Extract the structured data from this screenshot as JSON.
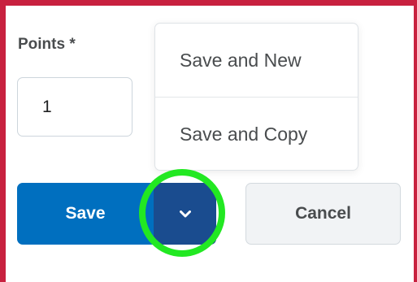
{
  "form": {
    "points_label": "Points *",
    "points_value": "1"
  },
  "save_menu": {
    "items": [
      {
        "label": "Save and New"
      },
      {
        "label": "Save and Copy"
      }
    ]
  },
  "actions": {
    "save_label": "Save",
    "cancel_label": "Cancel",
    "dropdown_icon": "chevron-down-icon"
  },
  "colors": {
    "frame_border": "#c8213f",
    "primary": "#006fbf",
    "primary_dark": "#1a4c8f",
    "highlight": "#22e822"
  }
}
